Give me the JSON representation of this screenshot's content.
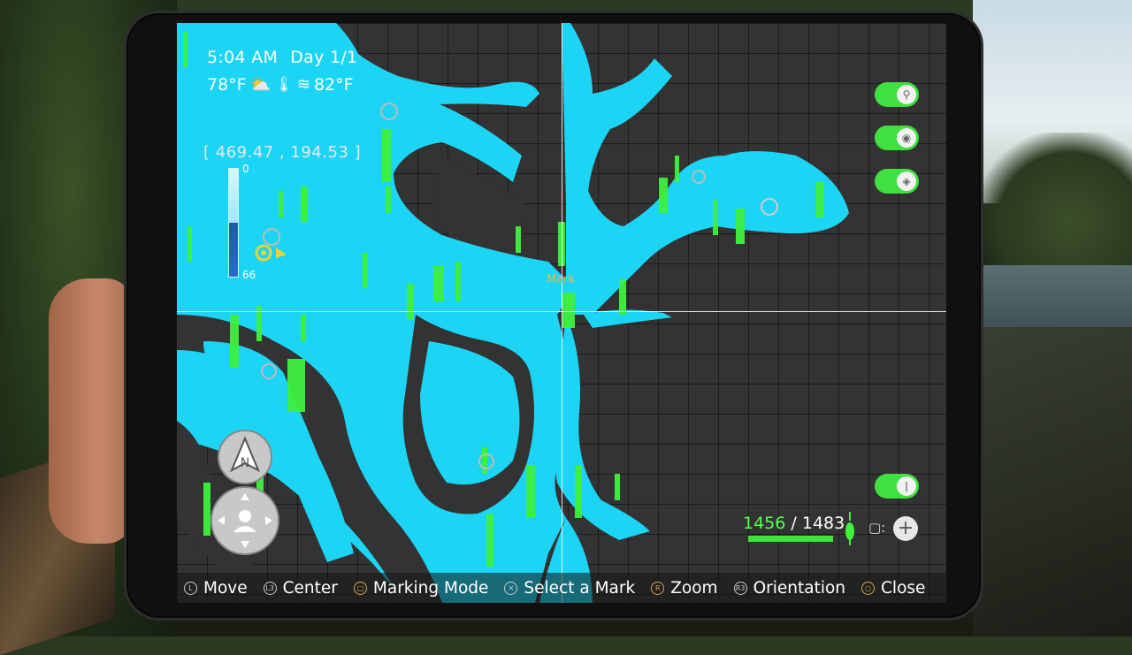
{
  "hud": {
    "time": "5:04 AM",
    "day": "Day 1/1",
    "air_temp": "78°F",
    "water_temp": "82°F",
    "coordinates": "[ 469.47 , 194.53 ]",
    "depth_min": "0",
    "depth_max": "66",
    "mark_label": "Mark"
  },
  "toggles": [
    {
      "name": "player-marker-toggle",
      "icon": "person-marker-icon",
      "on": true
    },
    {
      "name": "waypoint-toggle",
      "icon": "location-pin-icon",
      "on": true
    },
    {
      "name": "spot-toggle",
      "icon": "diamond-icon",
      "on": true
    },
    {
      "name": "lure-toggle",
      "icon": "bobber-icon",
      "on": true
    }
  ],
  "counter": {
    "current": "1456",
    "separator": "/",
    "total": "1483",
    "fraction": 0.982
  },
  "footer": [
    {
      "button": "L",
      "label": "Move"
    },
    {
      "button": "L3",
      "label": "Center"
    },
    {
      "button": "□",
      "label": "Marking Mode"
    },
    {
      "button": "✕",
      "label": "Select a Mark"
    },
    {
      "button": "R",
      "label": "Zoom"
    },
    {
      "button": "R3",
      "label": "Orientation"
    },
    {
      "button": "○",
      "label": "Close"
    }
  ],
  "colors": {
    "water": "#1cd4f4",
    "land_grid": "#333333",
    "fish_marker": "#3ff03f",
    "toggle_on": "#3fe03f",
    "mark_label": "#e6b84a"
  }
}
